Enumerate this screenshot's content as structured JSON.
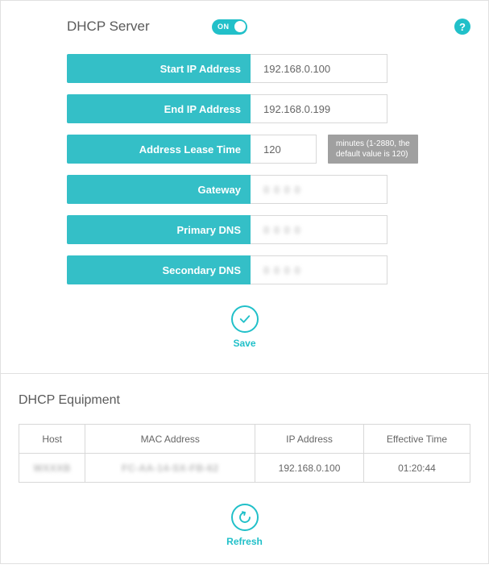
{
  "header": {
    "title": "DHCP Server",
    "toggle_state": "ON"
  },
  "fields": {
    "start_ip": {
      "label": "Start IP Address",
      "value": "192.168.0.100"
    },
    "end_ip": {
      "label": "End IP Address",
      "value": "192.168.0.199"
    },
    "lease": {
      "label": "Address Lease Time",
      "value": "120",
      "hint": "minutes (1-2880, the default value is 120)"
    },
    "gateway": {
      "label": "Gateway",
      "value": ""
    },
    "primary_dns": {
      "label": "Primary DNS",
      "value": ""
    },
    "secondary_dns": {
      "label": "Secondary DNS",
      "value": ""
    }
  },
  "actions": {
    "save": "Save",
    "refresh": "Refresh"
  },
  "equipment": {
    "title": "DHCP Equipment",
    "columns": {
      "host": "Host",
      "mac": "MAC Address",
      "ip": "IP Address",
      "time": "Effective Time"
    },
    "rows": [
      {
        "host": "",
        "mac": "",
        "ip": "192.168.0.100",
        "time": "01:20:44"
      }
    ]
  }
}
